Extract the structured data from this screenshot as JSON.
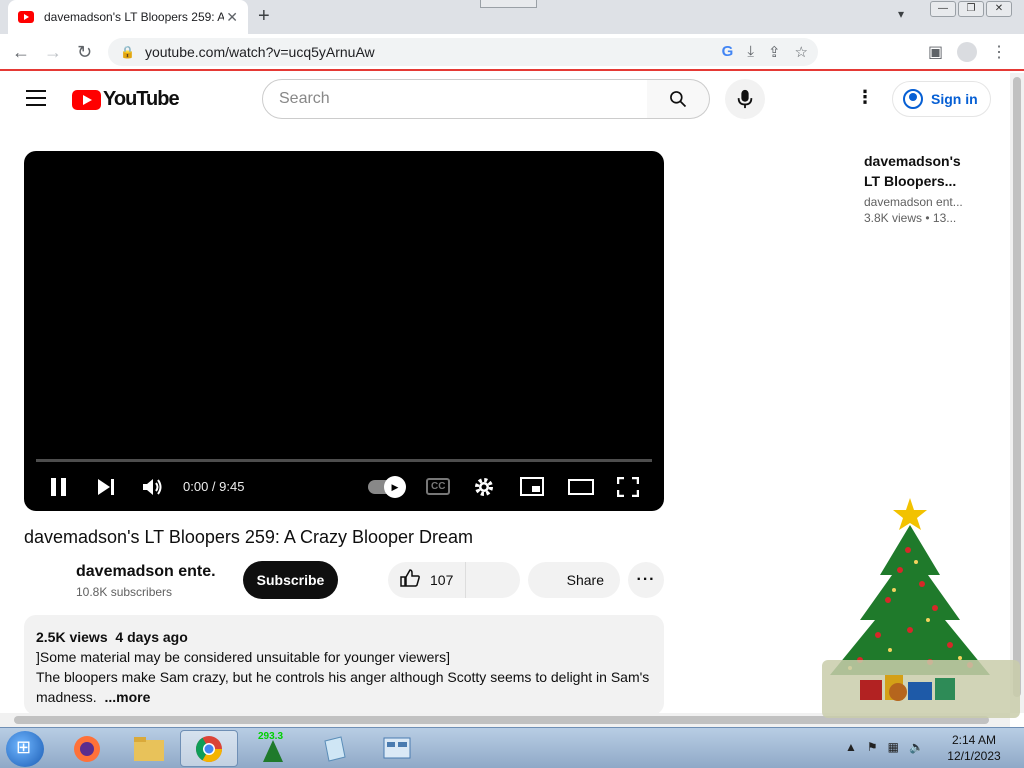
{
  "browser": {
    "tab_title": "davemadson's LT Bloopers 259: A",
    "url": "youtube.com/watch?v=ucq5yArnuAw"
  },
  "header": {
    "logo_text": "YouTube",
    "search_placeholder": "Search",
    "signin_label": "Sign in"
  },
  "player": {
    "time": "0:00 / 9:45",
    "progress": 0
  },
  "video": {
    "title": "davemadson's LT Bloopers 259: A Crazy Blooper Dream",
    "channel": "davemadson ente...",
    "subscribers": "10.8K subscribers",
    "subscribe_label": "Subscribe",
    "likes": "107",
    "share_label": "Share"
  },
  "description": {
    "views": "2.5K views",
    "age": "4 days ago",
    "line1": "]Some material may be considered unsuitable for younger viewers]",
    "line2": "The bloopers make Sam crazy, but he controls his anger although Scotty seems to delight in Sam's",
    "line3": "madness.",
    "more_label": "...more"
  },
  "suggestion": {
    "title_line1": "davemadson's",
    "title_line2": "LT Bloopers...",
    "channel": "davemadson ent...",
    "views": "3.8K views",
    "age": "• 13..."
  },
  "taskbar": {
    "gadget_value": "293.3",
    "clock_time": "2:14 AM",
    "clock_date": "12/1/2023"
  },
  "colors": {
    "youtube_red": "#ff0000",
    "link_blue": "#065fd4",
    "toolbar_accent": "#e53935"
  }
}
